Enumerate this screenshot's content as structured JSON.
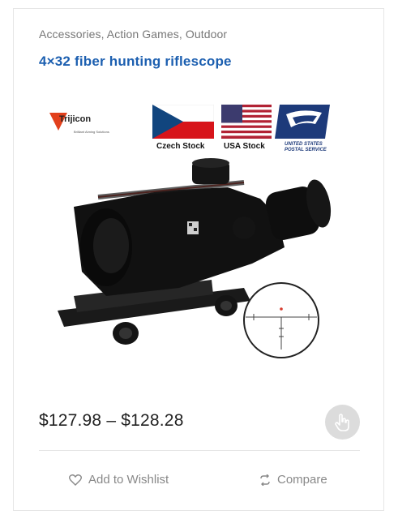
{
  "product": {
    "categories": "Accessories, Action Games, Outdoor",
    "title": "4×32 fiber hunting riflescope",
    "price": "$127.98 – $128.28"
  },
  "image": {
    "brand_logo": "Trijicon",
    "brand_tagline": "Brilliant Aiming Solutions",
    "flag_czech_label": "Czech Stock",
    "flag_usa_label": "USA Stock",
    "usps_label_line1": "UNITED STATES",
    "usps_label_line2": "POSTAL SERVICE"
  },
  "actions": {
    "wishlist_label": "Add to Wishlist",
    "compare_label": "Compare"
  },
  "icons": {
    "hand": "hand-pointer-icon",
    "heart": "heart-icon",
    "compare": "compare-arrows-icon"
  },
  "colors": {
    "title": "#1c5fb0",
    "text_muted": "#888888",
    "button_bg": "#dcdcdc"
  }
}
